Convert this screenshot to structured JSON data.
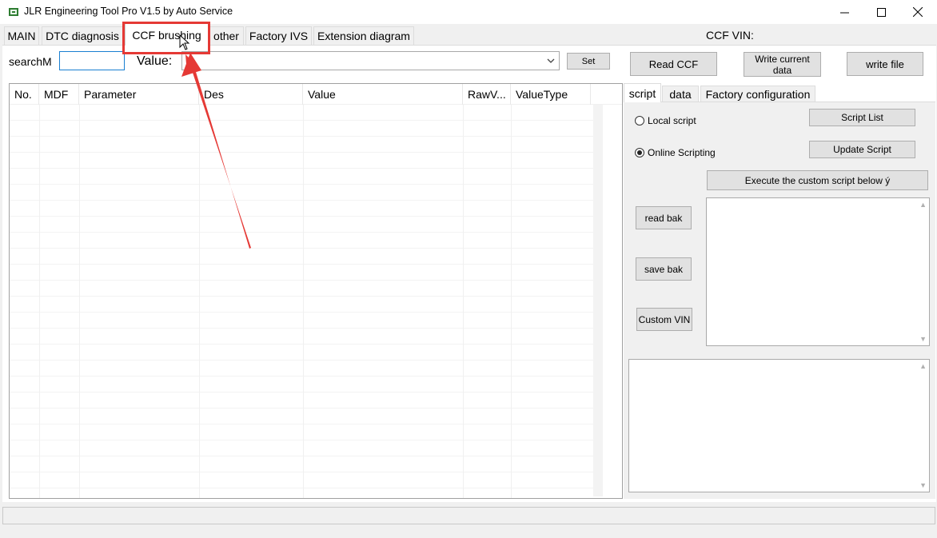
{
  "window": {
    "title": "JLR Engineering Tool Pro V1.5 by Auto Service",
    "minimize_glyph": "—",
    "maximize_glyph": "☐",
    "close_glyph": "✕"
  },
  "main_tabs": [
    {
      "label": "MAIN"
    },
    {
      "label": "DTC diagnosis"
    },
    {
      "label": "CCF brushing",
      "active": true
    },
    {
      "label": "other"
    },
    {
      "label": "Factory IVS"
    },
    {
      "label": "Extension diagram"
    }
  ],
  "header": {
    "ccf_vin_label": "CCF VIN:"
  },
  "search": {
    "label": "searchM",
    "value": "",
    "value_label": "Value:",
    "set_label": "Set"
  },
  "actions": {
    "read_ccf": "Read CCF",
    "write_current": "Write current data",
    "write_file": "write file"
  },
  "grid": {
    "columns": [
      "No.",
      "MDF",
      "Parameter",
      "Des",
      "Value",
      "RawV...",
      "ValueType"
    ]
  },
  "right_tabs": [
    {
      "label": "script",
      "active": true
    },
    {
      "label": "data"
    },
    {
      "label": "Factory configuration"
    }
  ],
  "script_panel": {
    "local_script": "Local script",
    "online_scripting": "Online Scripting",
    "selected": "online",
    "script_list": "Script List",
    "update_script": "Update Script",
    "execute": "Execute the custom script below ý",
    "read_bak": "read bak",
    "save_bak": "save bak",
    "custom_vin": "Custom VIN"
  },
  "colors": {
    "highlight": "#e53935",
    "accent_focus": "#1a7fd1"
  }
}
